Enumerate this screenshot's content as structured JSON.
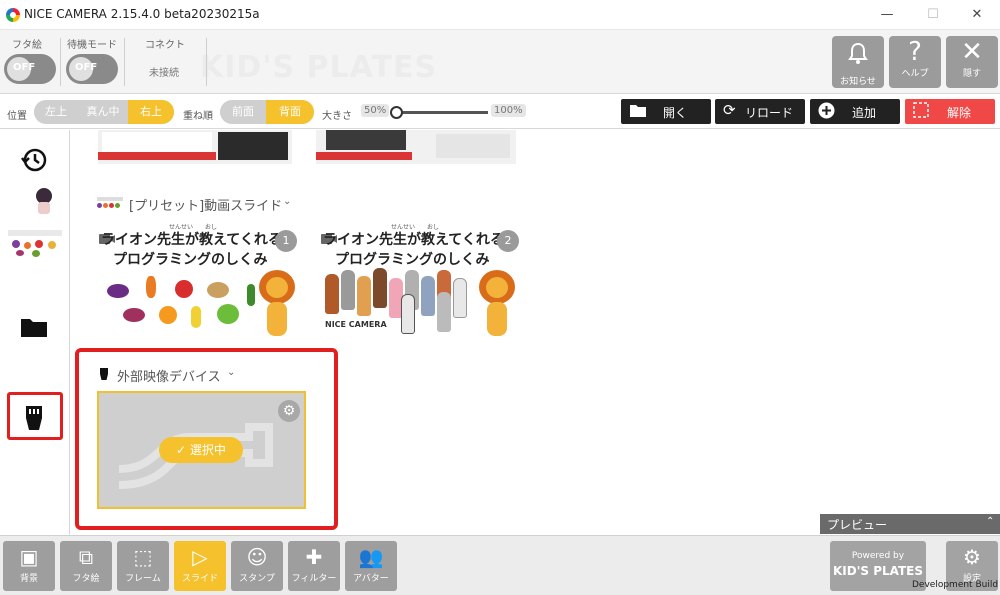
{
  "window": {
    "title": "NICE CAMERA 2.15.4.0 beta20230215a",
    "controls": [
      "—",
      "☐",
      "✕"
    ]
  },
  "topbar": {
    "lid_label": "フタ絵",
    "lid_toggle": "OFF",
    "standby_label": "待機モード",
    "standby_toggle": "OFF",
    "connect_label": "コネクト",
    "connect_status": "未接続",
    "watermark": "KID'S PLATES",
    "buttons": [
      {
        "icon": "bell-icon",
        "label": "お知らせ"
      },
      {
        "icon": "help-icon",
        "label": "ヘルプ"
      },
      {
        "icon": "close-icon",
        "label": "隠す"
      }
    ]
  },
  "settings": {
    "position_label": "位置",
    "position_options": [
      "左上",
      "真ん中",
      "右上"
    ],
    "position_selected": "右上",
    "order_label": "重ね順",
    "order_options": [
      "前面",
      "背面"
    ],
    "order_selected": "背面",
    "size_label": "大きさ",
    "size_min": "50%",
    "size_max": "100%",
    "size_level": 0,
    "open_label": "開く",
    "reload_label": "リロード",
    "add_label": "追加",
    "remove_label": "解除"
  },
  "main": {
    "preset_group": "[プリセット]動画スライド",
    "slides": [
      {
        "number": "1",
        "ruby": "せんせい　　おし",
        "title_line1": "ライオン先生が教えてくれる",
        "title_line2": "プログラミングのしくみ"
      },
      {
        "number": "2",
        "ruby": "せんせい　　おし",
        "title_line1": "ライオン先生が教えてくれる",
        "title_line2": "プログラミングのしくみ",
        "logo": "NICE CAMERA"
      }
    ],
    "device_group": "外部映像デバイス",
    "device_selected": "選択中"
  },
  "preview_label": "プレビュー",
  "bottom_tabs": [
    {
      "icon": "image-icon",
      "label": "背景"
    },
    {
      "icon": "lid-art-icon",
      "label": "フタ絵"
    },
    {
      "icon": "frame-icon",
      "label": "フレーム"
    },
    {
      "icon": "slide-icon",
      "label": "スライド",
      "active": true
    },
    {
      "icon": "stamp-icon",
      "label": "スタンプ"
    },
    {
      "icon": "filter-icon",
      "label": "フィルター"
    },
    {
      "icon": "avatar-icon",
      "label": "アバター"
    }
  ],
  "footer": {
    "powered_by": "Powered by",
    "brand": "KID'S PLATES",
    "settings_label": "設定",
    "build": "Development Build"
  },
  "colors": {
    "accent": "#f5c22e",
    "highlight_red": "#e21f1f",
    "remove_red": "#f04747",
    "button_gray": "#9e9e9e"
  }
}
